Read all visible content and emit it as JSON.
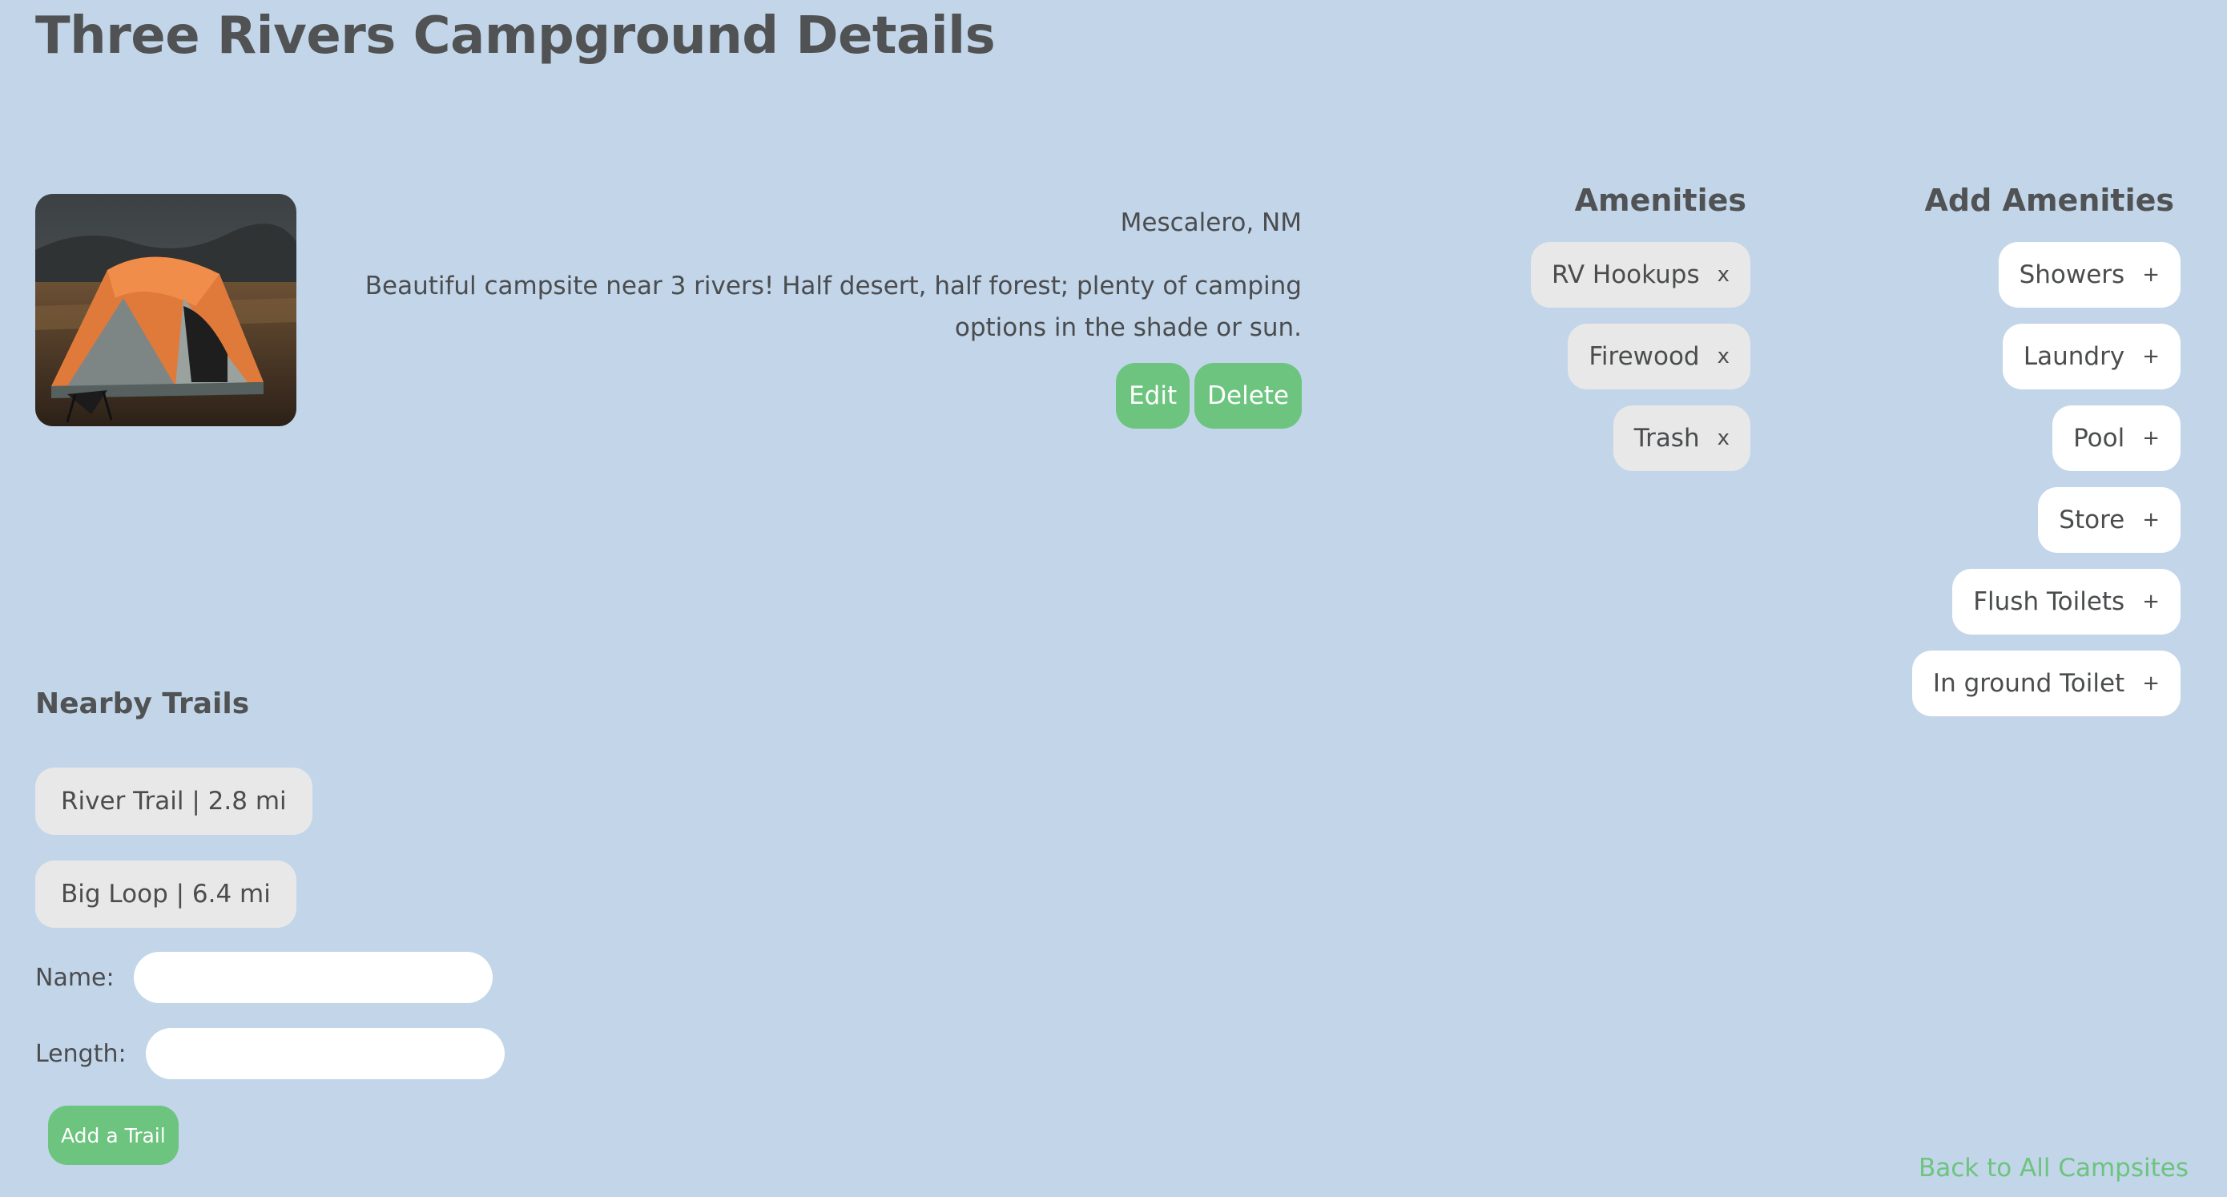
{
  "page": {
    "title": "Three Rivers Campground Details"
  },
  "campsite": {
    "photo_alt": "tent-photo",
    "location": "Mescalero, NM",
    "description": "Beautiful campsite near 3 rivers! Half desert, half forest; plenty of camping options in the shade or sun.",
    "edit_label": "Edit",
    "delete_label": "Delete"
  },
  "amenities": {
    "heading": "Amenities",
    "remove_symbol": "x",
    "items": [
      "RV Hookups",
      "Firewood",
      "Trash"
    ]
  },
  "add_amenities": {
    "heading": "Add Amenities",
    "add_symbol": "+",
    "items": [
      "Showers",
      "Laundry",
      "Pool",
      "Store",
      "Flush Toilets",
      "In ground Toilet"
    ]
  },
  "trails": {
    "heading": "Nearby Trails",
    "items": [
      {
        "label": "River Trail | 2.8 mi"
      },
      {
        "label": "Big Loop | 6.4 mi"
      }
    ]
  },
  "trail_form": {
    "name_label": "Name:",
    "name_value": "",
    "length_label": "Length:",
    "length_value": "",
    "submit_label": "Add a Trail"
  },
  "nav": {
    "back_label": "Back to All Campsites"
  },
  "colors": {
    "background": "#c2d5e9",
    "accent_green": "#6cc47e",
    "chip_grey": "#e8e8e8",
    "chip_white": "#ffffff"
  }
}
